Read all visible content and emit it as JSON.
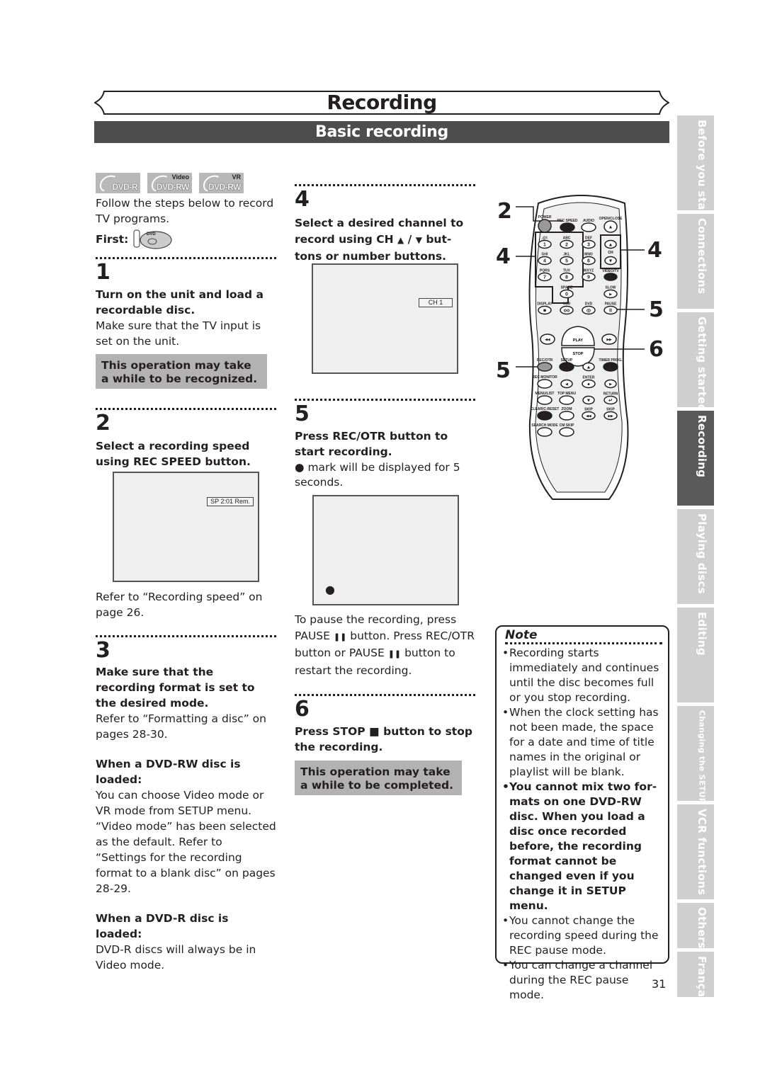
{
  "header": {
    "title": "Recording",
    "subtitle": "Basic recording"
  },
  "side_tabs": [
    {
      "label": "Before you start",
      "active": false
    },
    {
      "label": "Connections",
      "active": false
    },
    {
      "label": "Getting started",
      "active": false
    },
    {
      "label": "Recording",
      "active": true
    },
    {
      "label": "Playing discs",
      "active": false
    },
    {
      "label": "Editing",
      "active": false
    },
    {
      "label": "Changing the SETUP menu",
      "active": false
    },
    {
      "label": "VCR functions",
      "active": false
    },
    {
      "label": "Others",
      "active": false
    },
    {
      "label": "Français",
      "active": false
    }
  ],
  "intro": {
    "disc_logos": [
      {
        "label": "DVD-R",
        "top": ""
      },
      {
        "label": "DVD-RW",
        "top": "Video"
      },
      {
        "label": "DVD-RW",
        "top": "VR"
      }
    ],
    "text": "Follow the steps below to record TV programs.",
    "first_label": "First:",
    "first_icon": "dvd-mode-icon",
    "dvd_label": "DVD"
  },
  "steps": [
    {
      "number": "1",
      "heading": "Turn on the unit and load a recordable disc.",
      "body": "Make sure that the TV input is set on the unit.",
      "callout": "This operation may take a while to be recognized."
    },
    {
      "number": "2",
      "heading": "Select a recording speed using REC SPEED button.",
      "screen_osd": "SP 2:01 Rem.",
      "body": "Refer to “Recording speed” on page 26."
    },
    {
      "number": "3",
      "heading": "Make sure that the recording format is set to the desired mode.",
      "body": "Refer to “Formatting a disc” on pages 28-30.",
      "sub1_heading": "When a DVD-RW disc is loaded:",
      "sub1_body": "You can choose Video mode or VR mode from SETUP menu. “Video mode” has been selected as the default. Refer to “Settings for the recording format to a blank disc” on pages 28-29.",
      "sub2_heading": "When a DVD-R disc is loaded:",
      "sub2_body": "DVD-R discs will always be in Video mode."
    },
    {
      "number": "4",
      "heading_a": "Select a desired channel to record using CH ",
      "heading_b": "▲",
      "heading_c": " / ",
      "heading_d": "▼",
      "heading_e": " but-tons or number buttons.",
      "screen_osd": "CH 1"
    },
    {
      "number": "5",
      "heading": "Press REC/OTR button to start recording.",
      "body_mark": "●",
      "body": " mark will be displayed for 5 seconds.",
      "screen_mark": "●",
      "pause_text_1": "To pause the recording, press PAUSE ",
      "pause_glyph": "❚❚",
      "pause_text_2": " button. Press REC/OTR button or PAUSE ",
      "pause_text_3": " button to restart the recording."
    },
    {
      "number": "6",
      "heading_a": "Press STOP ",
      "heading_glyph": "■",
      "heading_b": " button to stop the recording.",
      "callout": "This operation may take a while to be completed."
    }
  ],
  "note": {
    "title": "Note",
    "items": [
      {
        "text": "Recording starts immediately and continues until the disc becomes full or you stop recording.",
        "bold": false
      },
      {
        "text": "When the clock setting has not been made, the space for a date and time of title names in the original or playlist will be blank.",
        "bold": false
      },
      {
        "text": "You cannot mix two for-mats on one DVD-RW disc. When you load a disc once recorded before, the recording format cannot be changed even if you change it in SETUP menu.",
        "bold": true
      },
      {
        "text": "You cannot change the recording speed during the REC pause mode.",
        "bold": false
      },
      {
        "text": "You can change a channel during the REC pause mode.",
        "bold": false
      }
    ]
  },
  "remote": {
    "callouts": [
      "2",
      "4",
      "4",
      "5",
      "6",
      "5"
    ],
    "labels": {
      "power": "POWER",
      "rec_speed": "REC SPEED",
      "audio": "AUDIO",
      "open_close": "OPEN/CLOSE",
      "k1": ".@/:",
      "k2": "ABC",
      "k3": "DEF",
      "k4": "GHI",
      "k5": "JKL",
      "k6": "MNO",
      "k7": "PQRS",
      "k8": "TUV",
      "k9": "WXYZ",
      "space": "SPACE",
      "ch": "CH",
      "video_tv": "VIDEO/TV",
      "slow": "SLOW",
      "display": "DISPLAY",
      "vcr": "VCR",
      "dvd": "DVD",
      "pause": "PAUSE",
      "play": "PLAY",
      "stop": "STOP",
      "rec_otr": "REC/OTR",
      "setup": "SETUP",
      "timer_prog": "TIMER PROG.",
      "rec_monitor": "REC MONITOR",
      "enter": "ENTER",
      "menu_list": "MENU/LIST",
      "top_menu": "TOP MENU",
      "return": "RETURN",
      "clear": "CLEAR/C-RESET",
      "zoom": "ZOOM",
      "skip1": "SKIP",
      "skip2": "SKIP",
      "search_mode": "SEARCH MODE",
      "cm_skip": "CM SKIP"
    },
    "digits": [
      "1",
      "2",
      "3",
      "4",
      "5",
      "6",
      "7",
      "8",
      "9",
      "0"
    ]
  },
  "page_number": "31"
}
